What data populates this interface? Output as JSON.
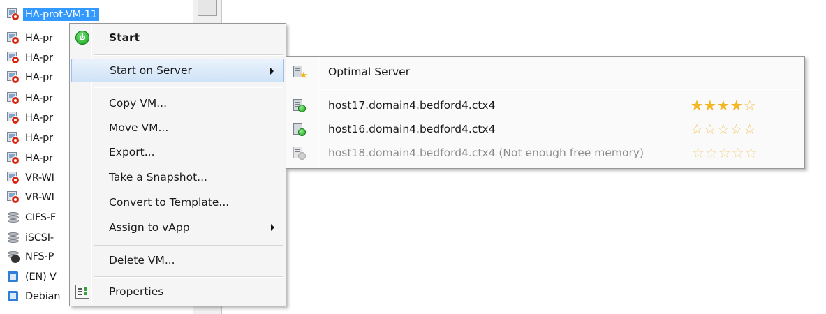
{
  "tree": {
    "items": [
      {
        "label": "HA-prot-VM-11",
        "icon": "vm-halted-icon",
        "selected": true
      },
      {
        "label": "HA-pr",
        "icon": "vm-halted-icon"
      },
      {
        "label": "HA-pr",
        "icon": "vm-halted-icon"
      },
      {
        "label": "HA-pr",
        "icon": "vm-halted-icon"
      },
      {
        "label": "HA-pr",
        "icon": "vm-halted-icon"
      },
      {
        "label": "HA-pr",
        "icon": "vm-halted-icon"
      },
      {
        "label": "HA-pr",
        "icon": "vm-halted-icon"
      },
      {
        "label": "HA-pr",
        "icon": "vm-halted-icon"
      },
      {
        "label": "VR-WI",
        "icon": "vm-halted-icon"
      },
      {
        "label": "VR-WI",
        "icon": "vm-halted-icon"
      },
      {
        "label": "CIFS-F",
        "icon": "storage-repository-icon"
      },
      {
        "label": "iSCSI-",
        "icon": "storage-repository-icon"
      },
      {
        "label": "NFS-P",
        "icon": "storage-nfs-icon"
      },
      {
        "label": "(EN) V",
        "icon": "template-icon"
      },
      {
        "label": "Debian",
        "icon": "template-icon"
      }
    ]
  },
  "context_menu": {
    "start": "Start",
    "start_on_server": "Start on Server",
    "copy_vm": "Copy VM...",
    "move_vm": "Move VM...",
    "export": "Export...",
    "take_snapshot": "Take a Snapshot...",
    "convert_to_template": "Convert to Template...",
    "assign_to_vapp": "Assign to vApp",
    "delete_vm": "Delete VM...",
    "properties": "Properties"
  },
  "submenu": {
    "optimal_server": "Optimal Server",
    "hosts": [
      {
        "label": "host17.domain4.bedford4.ctx4",
        "rating": 4,
        "max_rating": 5,
        "enabled": true
      },
      {
        "label": "host16.domain4.bedford4.ctx4",
        "rating": 0,
        "max_rating": 5,
        "enabled": true
      },
      {
        "label": "host18.domain4.bedford4.ctx4 (Not enough free memory)",
        "rating": 0,
        "max_rating": 5,
        "enabled": false
      }
    ]
  },
  "colors": {
    "selection": "#3399ff",
    "star": "#f5b820",
    "disabled_text": "#8c8c8c",
    "status_stopped": "#d8260f",
    "status_running": "#1a9e1a"
  }
}
